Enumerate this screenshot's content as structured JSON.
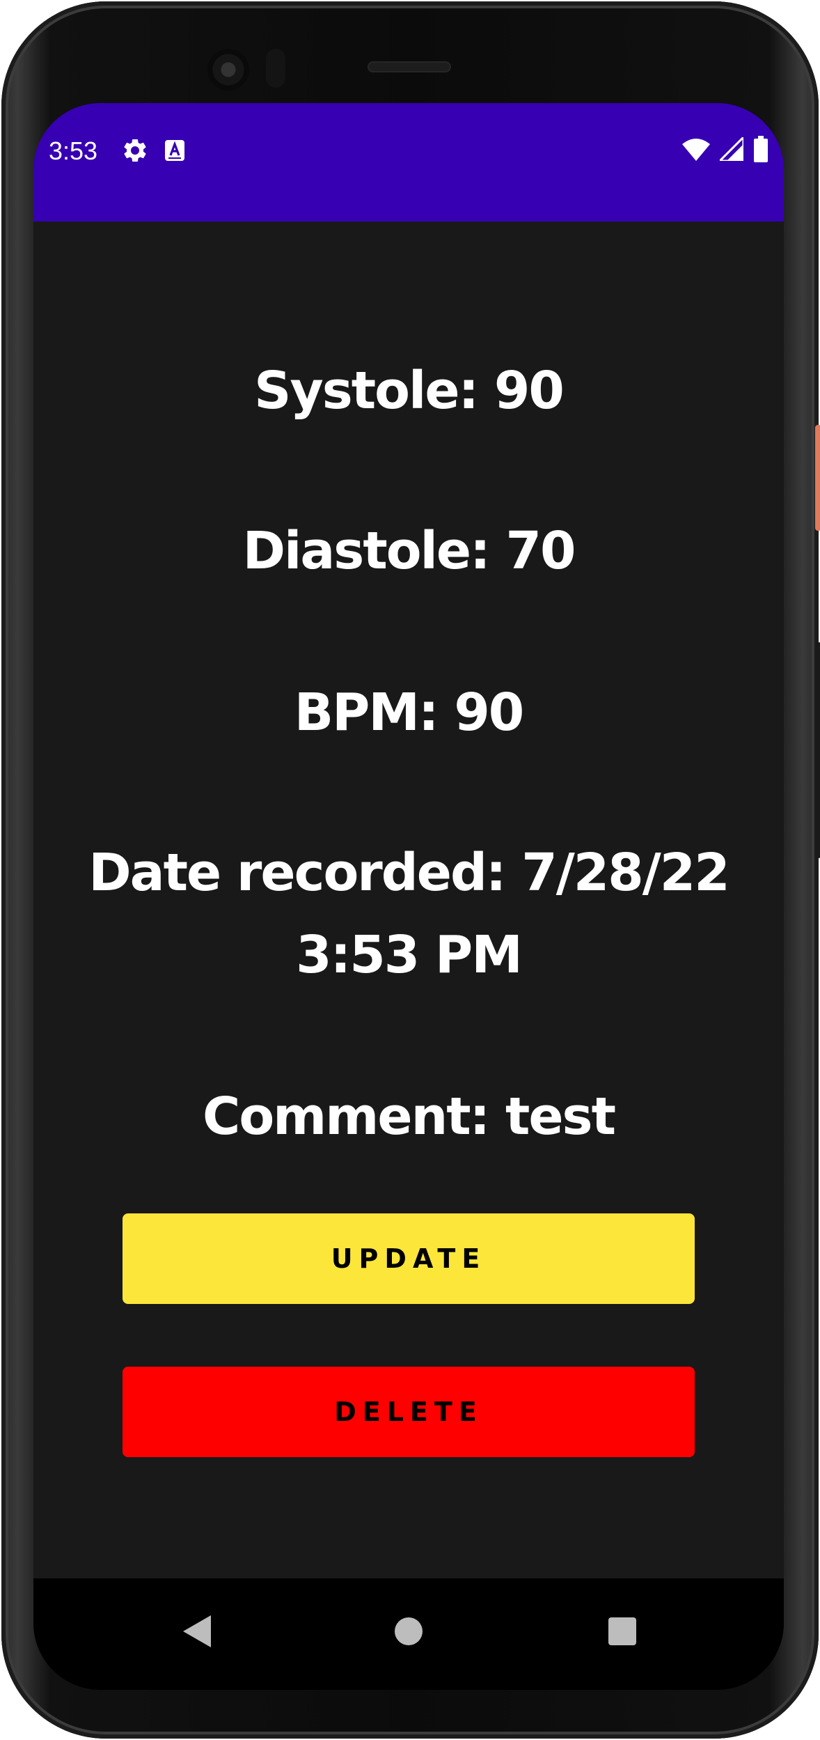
{
  "status_bar": {
    "time": "3:53",
    "background_color": "#3700b3",
    "left_icons": [
      "settings-gear-icon",
      "keyboard-a-icon"
    ],
    "right_icons": [
      "wifi-icon",
      "cellular-signal-icon",
      "battery-icon"
    ]
  },
  "reading": {
    "systole": "Systole: 90",
    "diastole": "Diastole: 70",
    "bpm": "BPM: 90",
    "date_recorded_line1": "Date recorded: 7/28/22",
    "date_recorded_line2": "3:53 PM",
    "comment": "Comment: test"
  },
  "actions": {
    "update_label": "UPDATE",
    "update_color": "#fde63a",
    "delete_label": "DELETE",
    "delete_color": "#ff0000"
  },
  "nav": {
    "icons": [
      "back-triangle-icon",
      "home-circle-icon",
      "recents-square-icon"
    ]
  },
  "theme": {
    "background": "#191919",
    "text": "#ffffff"
  }
}
